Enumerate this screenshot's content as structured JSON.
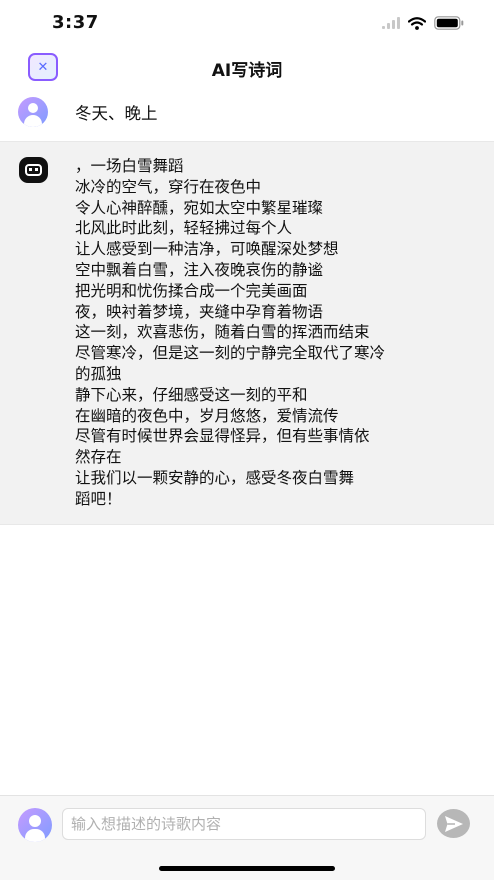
{
  "status_bar": {
    "time": "3:37"
  },
  "nav": {
    "close_icon": "close-icon",
    "title": "AI写诗词"
  },
  "user_message": {
    "text": "冬天、晚上"
  },
  "ai_message": {
    "lines": [
      "，一场白雪舞蹈",
      "冰冷的空气，穿行在夜色中",
      "令人心神醉醺，宛如太空中繁星璀璨",
      "北风此时此刻，轻轻拂过每个人",
      "让人感受到一种洁净，可唤醒深处梦想",
      "空中飘着白雪，注入夜晚哀伤的静谧",
      "把光明和忧伤揉合成一个完美画面",
      "夜，映衬着梦境，夹缝中孕育着物语",
      "这一刻，欢喜悲伤，随着白雪的挥洒而结束",
      "尽管寒冷，但是这一刻的宁静完全取代了寒冷",
      "的孤独",
      "静下心来，仔细感受这一刻的平和",
      "在幽暗的夜色中，岁月悠悠，爱情流传",
      "尽管有时候世界会显得怪异，但有些事情依",
      "然存在",
      "让我们以一颗安静的心，感受冬夜白雪舞",
      "蹈吧！"
    ]
  },
  "input": {
    "placeholder": "输入想描述的诗歌内容",
    "value": ""
  },
  "colors": {
    "accent_purple": "#8a5cff",
    "ai_bubble_bg": "#f2f2f2",
    "send_button": "#b7b7b7"
  }
}
